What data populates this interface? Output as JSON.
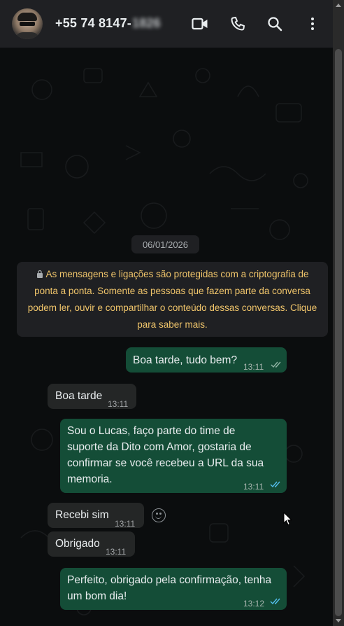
{
  "header": {
    "contact_name": "+55 74 8147-",
    "contact_name_obscured": "1826",
    "icons": [
      "video-call-icon",
      "voice-call-icon",
      "search-icon",
      "more-options-icon"
    ]
  },
  "chat": {
    "date": "06/01/2026",
    "encryption_notice": "As mensagens e ligações são protegidas com a criptografia de ponta a ponta. Somente as pessoas que fazem parte da conversa podem ler, ouvir e compartilhar o conteúdo dessas conversas. Clique para saber mais.",
    "messages": [
      {
        "direction": "out",
        "text": "Boa tarde, tudo bem?",
        "time": "13:11",
        "status": "read"
      },
      {
        "direction": "in",
        "text": "Boa tarde",
        "time": "13:11"
      },
      {
        "direction": "out",
        "text": "Sou o Lucas, faço parte do time de suporte da Dito com Amor, gostaria de confirmar se você recebeu a URL da sua memoria.",
        "time": "13:11",
        "status": "read"
      },
      {
        "direction": "in",
        "text": "Recebi sim",
        "time": "13:11"
      },
      {
        "direction": "in",
        "text": "Obrigado",
        "time": "13:11"
      },
      {
        "direction": "out",
        "text": "Perfeito, obrigado pela confirmação, tenha um bom dia!",
        "time": "13:12",
        "status": "read"
      }
    ]
  },
  "colors": {
    "header_bg": "#1f2023",
    "chat_bg": "#0b0d0e",
    "incoming_bubble": "#242626",
    "outgoing_bubble": "#144d37",
    "encryption_text": "#f0c56b",
    "read_ticks": "#53bdeb"
  }
}
